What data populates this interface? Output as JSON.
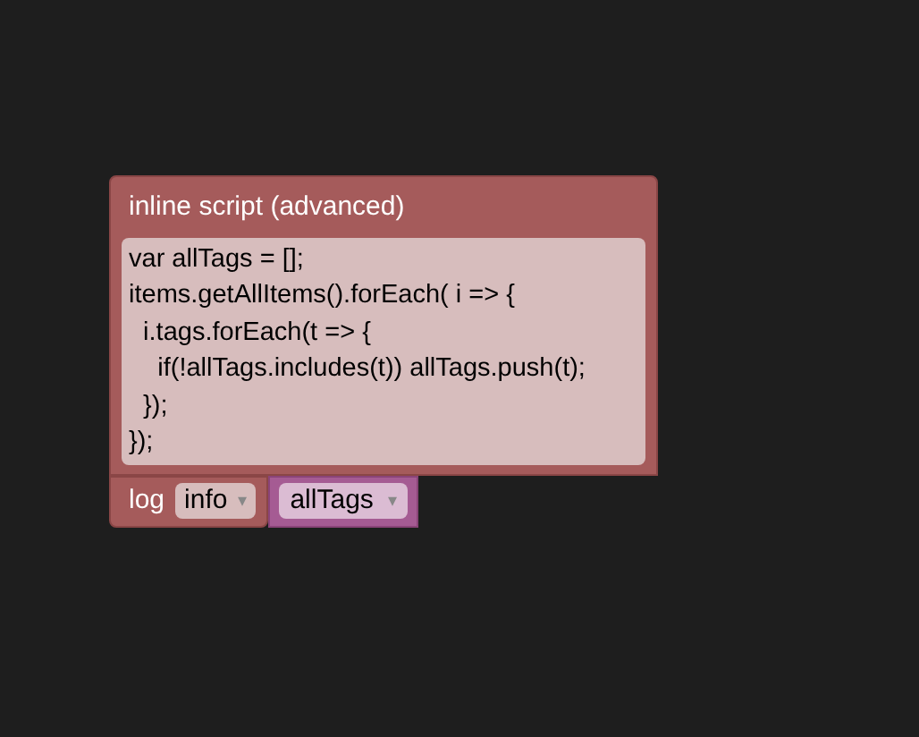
{
  "script_block": {
    "title": "inline script (advanced)",
    "code_lines": [
      "var allTags = [];",
      "items.getAllItems().forEach( i => {",
      "  i.tags.forEach(t => {",
      "    if(!allTags.includes(t)) allTags.push(t);",
      "  });",
      "});"
    ]
  },
  "log_block": {
    "label": "log",
    "level_dropdown": {
      "value": "info",
      "caret": "▾"
    },
    "variable_block": {
      "value": "allTags",
      "caret": "▾"
    }
  }
}
